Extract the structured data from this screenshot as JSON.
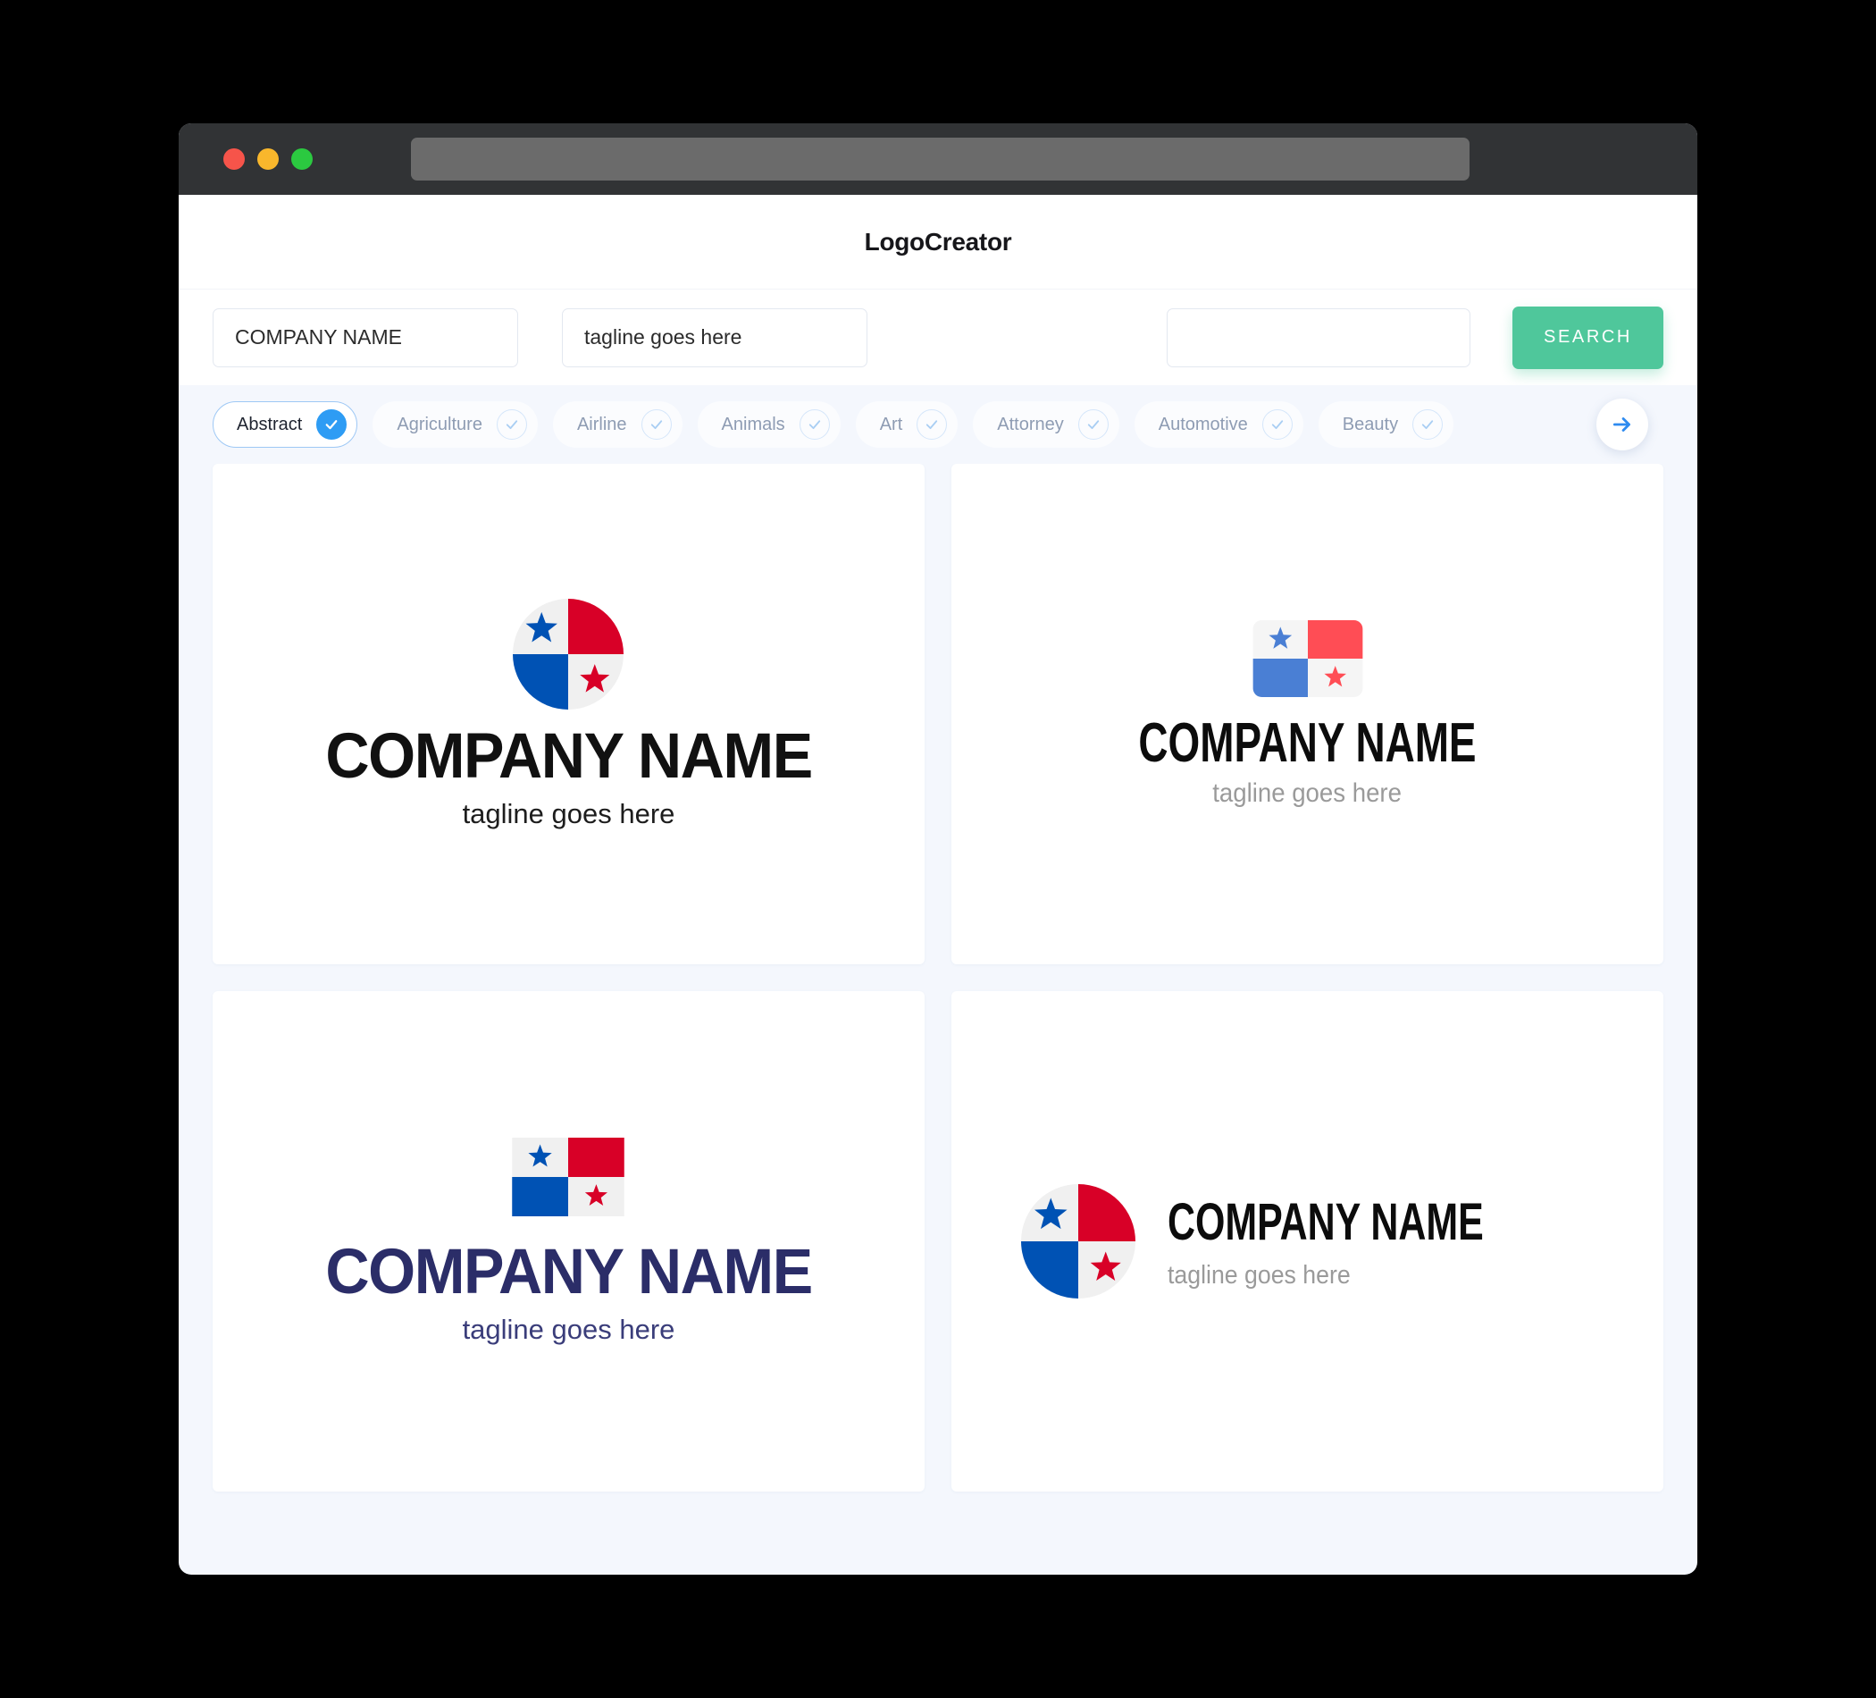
{
  "browser": {
    "traffic_lights": [
      "close",
      "minimize",
      "maximize"
    ],
    "address_bar_value": ""
  },
  "header": {
    "title": "LogoCreator"
  },
  "search": {
    "company_value": "COMPANY NAME",
    "company_placeholder": "COMPANY NAME",
    "tagline_value": "tagline goes here",
    "tagline_placeholder": "tagline goes here",
    "keyword_value": "",
    "keyword_placeholder": "",
    "search_button_label": "SEARCH",
    "search_button_color": "#4fc79b"
  },
  "categories": {
    "next_arrow_icon": "arrow-right-icon",
    "accent_color": "#2e9cf4",
    "items": [
      {
        "label": "Abstract",
        "selected": true
      },
      {
        "label": "Agriculture",
        "selected": false
      },
      {
        "label": "Airline",
        "selected": false
      },
      {
        "label": "Animals",
        "selected": false
      },
      {
        "label": "Art",
        "selected": false
      },
      {
        "label": "Attorney",
        "selected": false
      },
      {
        "label": "Automotive",
        "selected": false
      },
      {
        "label": "Beauty",
        "selected": false
      }
    ]
  },
  "results": {
    "cards": [
      {
        "id": "card-1",
        "layout": "stacked",
        "mark": "panama-flag-circle",
        "name": "COMPANY NAME",
        "tagline": "tagline goes here",
        "name_color": "#111111",
        "tagline_color": "#1d1d1d"
      },
      {
        "id": "card-2",
        "layout": "stacked",
        "mark": "panama-flag-rounded-rect",
        "name": "COMPANY NAME",
        "tagline": "tagline goes here",
        "name_color": "#0c0c0c",
        "tagline_color": "#9a9a9a"
      },
      {
        "id": "card-3",
        "layout": "stacked",
        "mark": "panama-flag-rect",
        "name": "COMPANY NAME",
        "tagline": "tagline goes here",
        "name_color": "#2b2d68",
        "tagline_color": "#3a3d7a"
      },
      {
        "id": "card-4",
        "layout": "horizontal",
        "mark": "panama-flag-circle",
        "name": "COMPANY NAME",
        "tagline": "tagline goes here",
        "name_color": "#0c0c0c",
        "tagline_color": "#9a9a9a"
      }
    ]
  },
  "palette": {
    "flag_blue_vivid": "#0052b4",
    "flag_red_vivid": "#d80027",
    "flag_white": "#f0f0f0",
    "flag_blue_soft": "#4a7fd4",
    "flag_red_soft": "#ff4d55",
    "flag_white_soft": "#f5f5f5",
    "page_background": "#f4f7fd",
    "titlebar": "#313335"
  }
}
